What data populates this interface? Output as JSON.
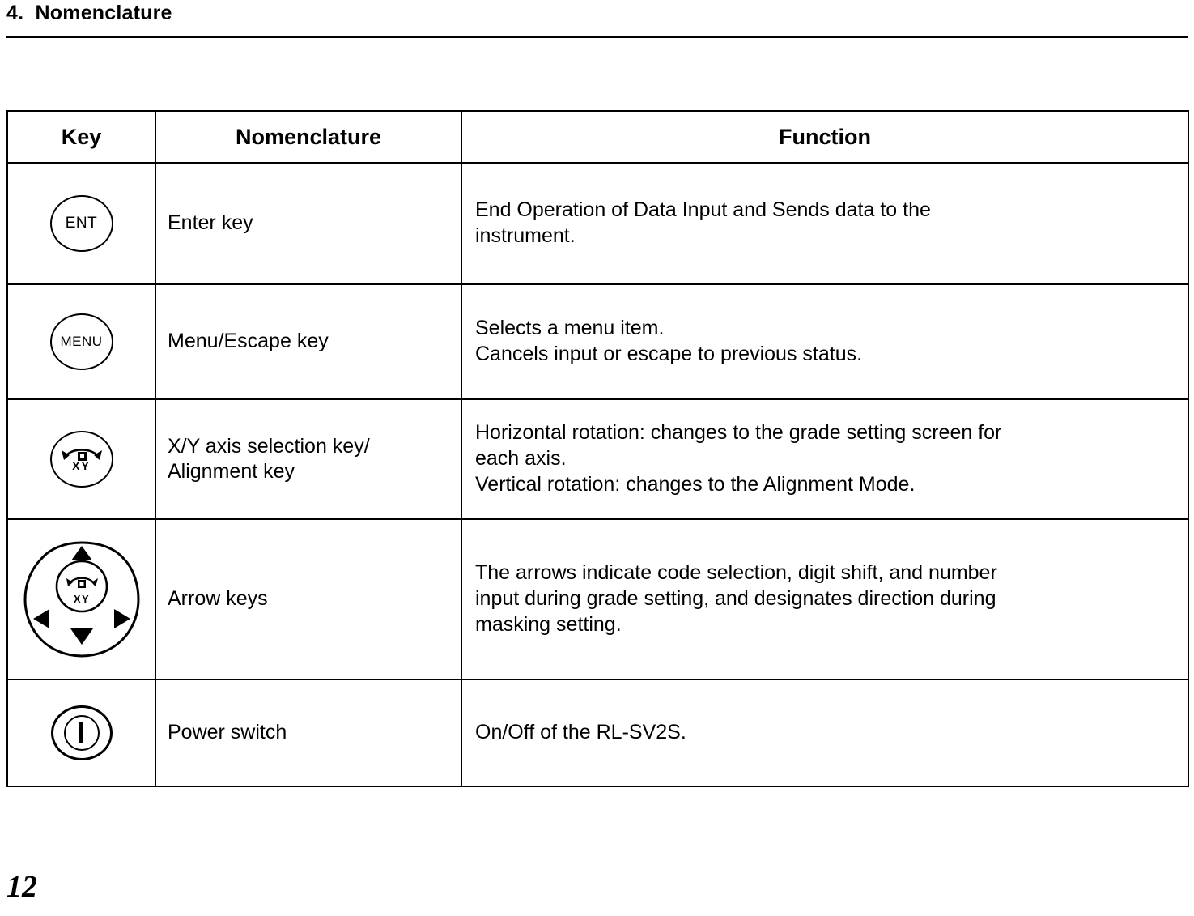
{
  "header": {
    "chapter_title": "4.  Nomenclature"
  },
  "table": {
    "columns": [
      "Key",
      "Nomenclature",
      "Function"
    ],
    "rows": [
      {
        "key_icon": "enter-key-icon",
        "key_label": "ENT",
        "nomenclature": "Enter key",
        "function_lines": [
          "End Operation of Data Input and Sends data to the",
          "instrument."
        ]
      },
      {
        "key_icon": "menu-escape-key-icon",
        "key_label": "MENU",
        "nomenclature": "Menu/Escape key",
        "function_lines": [
          "Selects a menu item.",
          "Cancels input or escape to previous status."
        ]
      },
      {
        "key_icon": "xy-axis-selection-key-icon",
        "key_label": "XY",
        "nomenclature_lines": [
          "X/Y axis selection key/",
          "Alignment key"
        ],
        "function_lines": [
          "Horizontal rotation: changes to the grade setting screen for",
          "each axis.",
          "Vertical rotation: changes to the Alignment Mode."
        ]
      },
      {
        "key_icon": "arrow-keys-icon",
        "key_label": "XY",
        "nomenclature": "Arrow keys",
        "function_lines": [
          "The arrows indicate code selection, digit shift, and number",
          "input during grade setting, and designates direction during",
          "masking setting."
        ]
      },
      {
        "key_icon": "power-switch-icon",
        "nomenclature": "Power switch",
        "function_lines": [
          "On/Off of the RL-SV2S."
        ]
      }
    ]
  },
  "footer": {
    "page_number": "12"
  }
}
